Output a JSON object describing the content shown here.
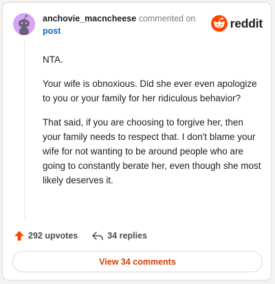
{
  "header": {
    "username": "anchovie_macncheese",
    "action_text": "commented on",
    "target_link": "post",
    "logo_text": "reddit"
  },
  "comment": {
    "paragraphs": [
      "NTA.",
      "Your wife is obnoxious. Did she ever even apologize to you or your family for her ridiculous behavior?",
      "That said, if you are choosing to forgive her, then your family needs to respect that. I don't blame your wife for not wanting to be around people who are going to constantly berate her, even though she most likely deserves it."
    ]
  },
  "actions": {
    "upvotes": "292 upvotes",
    "replies": "34 replies"
  },
  "footer": {
    "view_comments": "View 34 comments"
  },
  "colors": {
    "brand": "#ff4500",
    "link": "#0a66c2",
    "view_comments": "#d93a00",
    "avatar_bg": "#d6a6f3"
  },
  "icons": {
    "avatar": "snoo-avatar-icon",
    "logo": "reddit-snoo-icon",
    "upvote": "upvote-arrow-icon",
    "reply": "reply-arrow-icon"
  }
}
